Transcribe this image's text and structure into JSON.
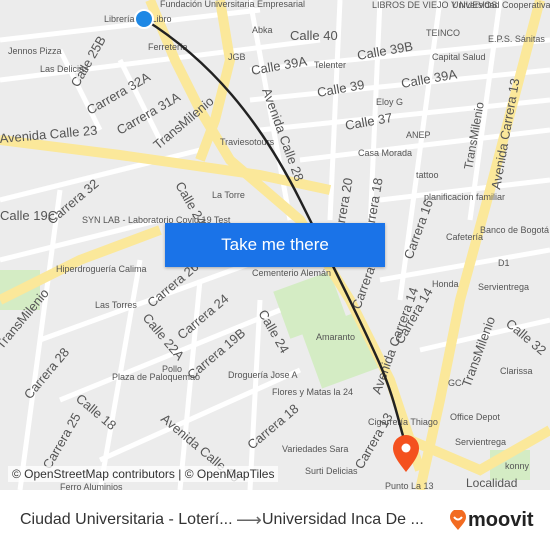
{
  "map": {
    "labels": [
      "Librería del Libro",
      "Fundación Universitaria Empresarial",
      "LIBROS DE VIEJO Y NUEVOS",
      "Universidad Cooperativa",
      "Calle 40",
      "Abka",
      "TEINCO",
      "E.P.S. Sánitas",
      "Jennos Pizza",
      "Calle 25B",
      "Ferretería",
      "Calle 39A",
      "Calle 39B",
      "Capital Salud",
      "Las Delicias",
      "Carrera 32A",
      "JGB",
      "Telenter",
      "Calle 39",
      "Calle 39A",
      "Carrera 31A",
      "Eloy G",
      "Avenida Calle 28",
      "Calle 37",
      "ANEP",
      "TransMilenio",
      "Avenida Calle 23",
      "Traviesotours",
      "Casa Morada",
      "TransMilenio",
      "Avenida Carrera 13",
      "Carrera 32",
      "La Torre",
      "Calle 24",
      "tattoo",
      "SYN LAB - Laboratorio Covid 19 Test",
      "planificacion familiar",
      "Carrera 20",
      "Carrera 18",
      "Cafetería",
      "Banco de Bogotá",
      "Carrera 16",
      "Cementerio Alemán",
      "Carrera 17",
      "Hiperdroguería Calima",
      "Carrera 26",
      "D1",
      "Honda",
      "Servientrega",
      "Las Torres",
      "Carrera 24",
      "TransMilenio",
      "Carrera 14",
      "Calle 22A",
      "Carrera 19B",
      "Calle 24",
      "Amaranto",
      "Avenida Carrera 14",
      "Calle 32",
      "Carrera 28",
      "Plaza de Paloquemao",
      "Pollo",
      "Droguería Jose A",
      "Flores y Matas la 24",
      "Clarissa",
      "GC",
      "Calle 18",
      "Carrera 25",
      "Avenida Calle 19",
      "Carrera 18",
      "Office Depot",
      "Cigarrería Thiago",
      "Servientrega",
      "Variedades Sara",
      "Surti Delicias",
      "Punto La 13",
      "konny",
      "Localidad",
      "TransMilenio",
      "Calle 19C",
      "Carrera 13",
      "Ferro Aluminios"
    ],
    "colors": {
      "route": "#222222",
      "origin": "#1e88e5",
      "destination": "#f4511e",
      "major_road": "#fbe89a",
      "park": "#d4ecc4"
    }
  },
  "cta": {
    "label": "Take me there"
  },
  "attribution": "© OpenStreetMap contributors | © OpenMapTiles",
  "footer": {
    "from": "Ciudad Universitaria - Loterí...",
    "arrow_icon": "arrow-right-icon",
    "to": "Universidad Inca De ...",
    "brand": "moovit",
    "brand_color": "#f26b21"
  }
}
